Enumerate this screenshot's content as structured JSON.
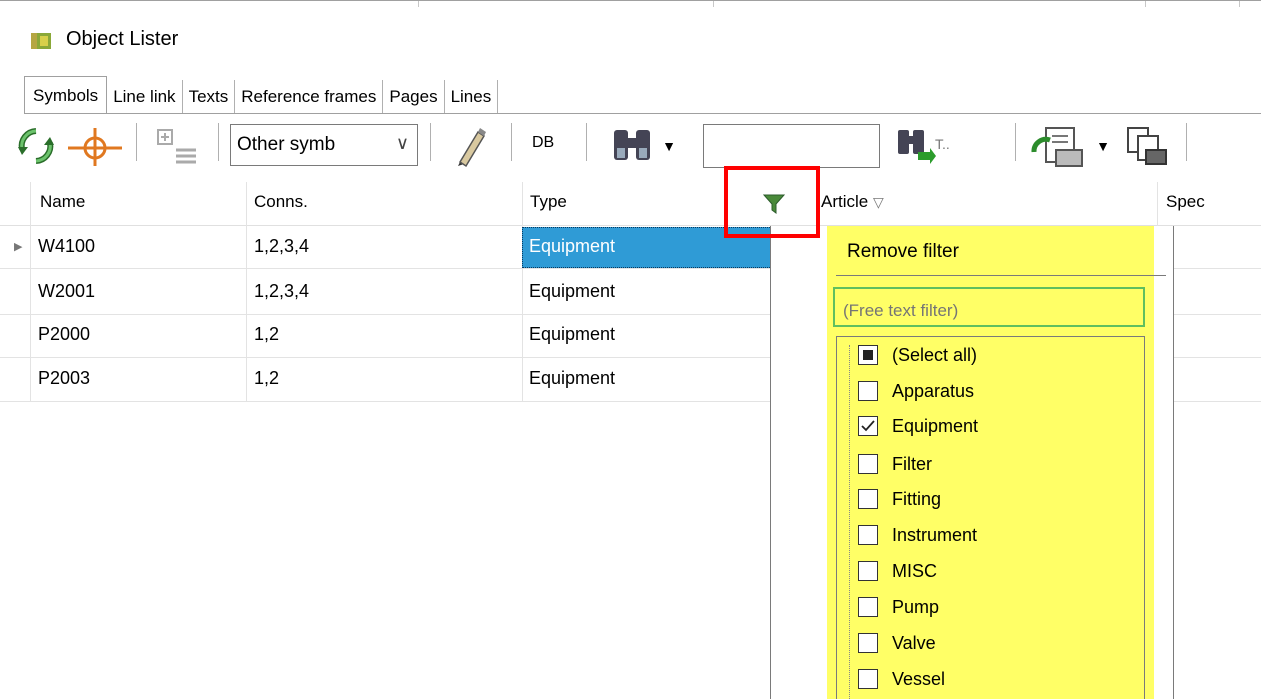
{
  "window": {
    "title": "Object Lister",
    "icon": "object-lister-icon"
  },
  "tabs": [
    {
      "label": "Symbols",
      "active": true
    },
    {
      "label": "Line link",
      "active": false
    },
    {
      "label": "Texts",
      "active": false
    },
    {
      "label": "Reference frames",
      "active": false
    },
    {
      "label": "Pages",
      "active": false
    },
    {
      "label": "Lines",
      "active": false
    }
  ],
  "toolbar": {
    "icons": [
      "refresh-icon",
      "crosshair-icon",
      "insert-row-icon",
      "pencil-icon",
      "binoculars-icon",
      "find-next-icon",
      "export-icon",
      "print-icon"
    ],
    "combo_value": "Other symb",
    "db_label": "DB",
    "search_value": "",
    "t_label": "T.."
  },
  "grid": {
    "columns": [
      "Name",
      "Conns.",
      "Type",
      "Article",
      "Spec"
    ],
    "rows": [
      {
        "name": "W4100",
        "conns": "1,2,3,4",
        "type": "Equipment",
        "current": true
      },
      {
        "name": "W2001",
        "conns": "1,2,3,4",
        "type": "Equipment",
        "current": false
      },
      {
        "name": "P2000",
        "conns": "1,2",
        "type": "Equipment",
        "current": false
      },
      {
        "name": "P2003",
        "conns": "1,2",
        "type": "Equipment",
        "current": false
      }
    ]
  },
  "filter_dropdown": {
    "remove_label": "Remove filter",
    "free_text_placeholder": "(Free text filter)",
    "items": [
      {
        "label": "(Select all)",
        "state": "partial"
      },
      {
        "label": "Apparatus",
        "state": "unchecked"
      },
      {
        "label": "Equipment",
        "state": "checked"
      },
      {
        "label": "Filter",
        "state": "unchecked"
      },
      {
        "label": "Fitting",
        "state": "unchecked"
      },
      {
        "label": "Instrument",
        "state": "unchecked"
      },
      {
        "label": "MISC",
        "state": "unchecked"
      },
      {
        "label": "Pump",
        "state": "unchecked"
      },
      {
        "label": "Valve",
        "state": "unchecked"
      },
      {
        "label": "Vessel",
        "state": "unchecked"
      }
    ]
  },
  "colors": {
    "highlight_yellow": "#ffff66",
    "annotation_red": "#ff0000",
    "selection_blue": "#2f9bd6",
    "filter_field_green": "#5fbf5f"
  }
}
